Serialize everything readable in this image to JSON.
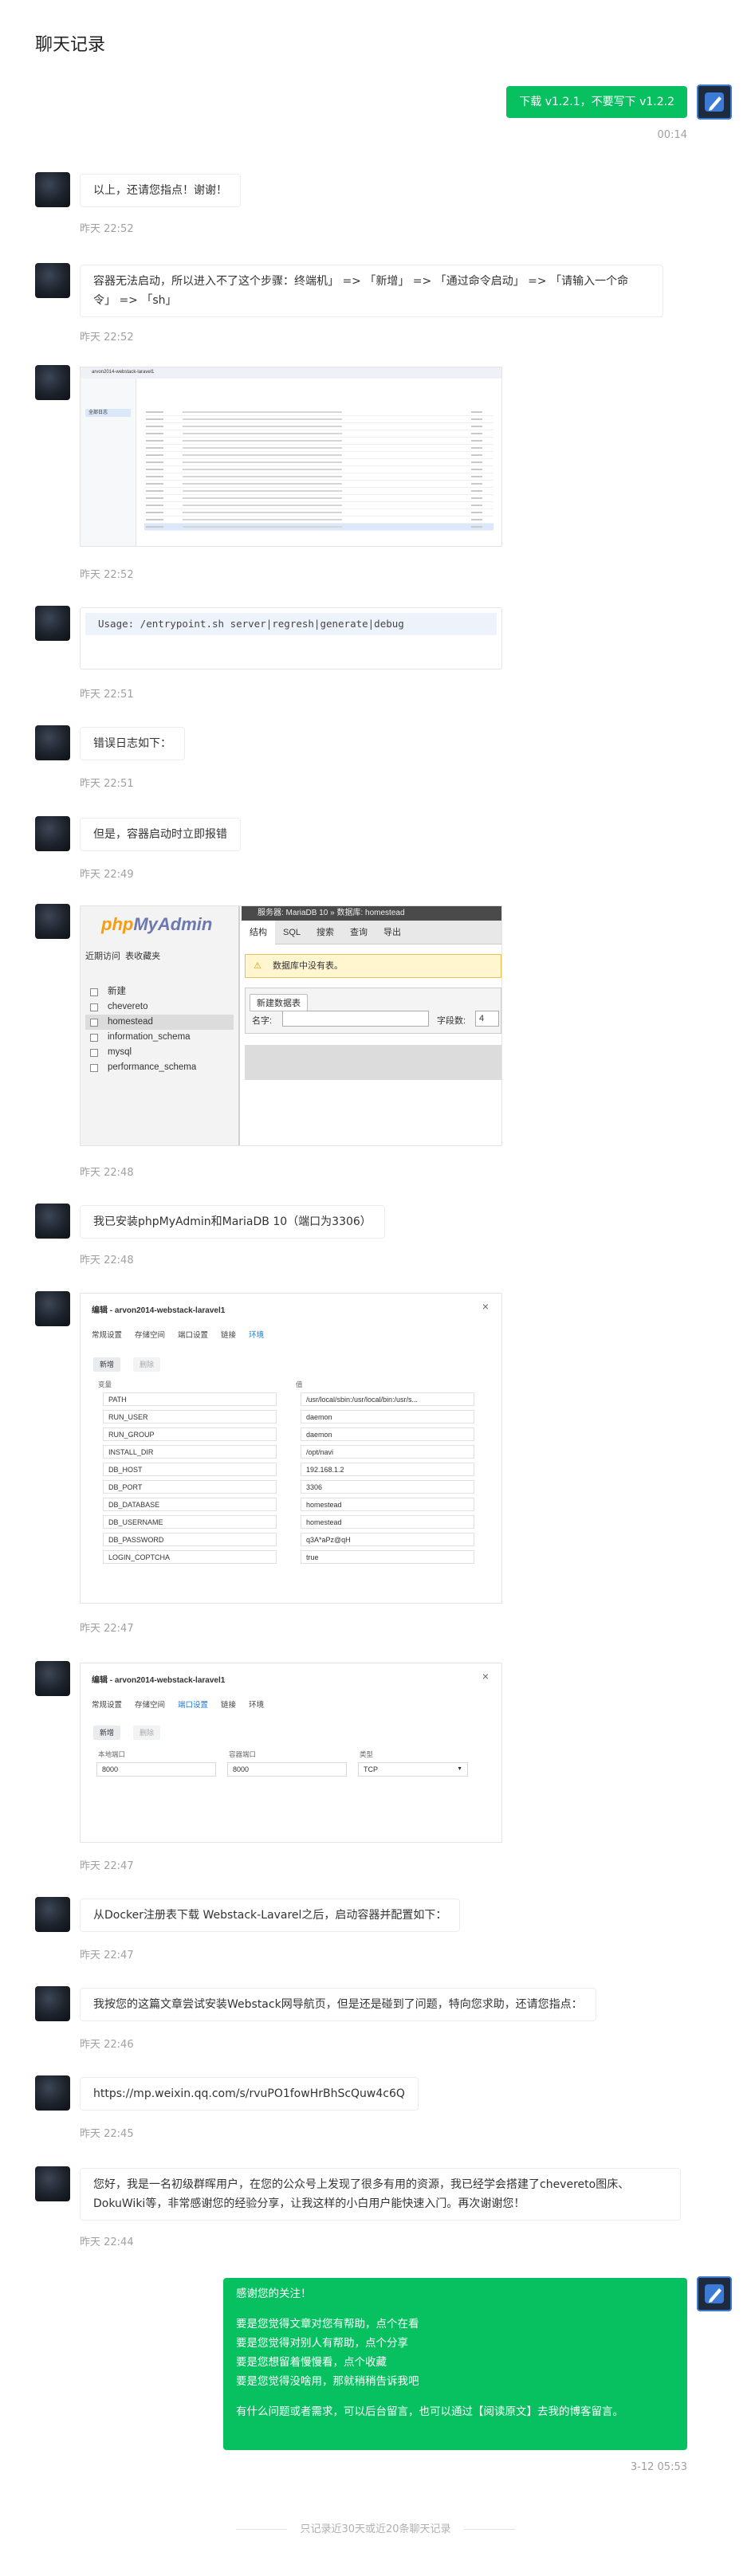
{
  "page": {
    "title": "聊天记录"
  },
  "messages": {
    "m01": {
      "text": "下载 v1.2.1，不要写下 v1.2.2",
      "time": "00:14"
    },
    "m02": {
      "text": "以上，还请您指点！谢谢！",
      "time": "昨天 22:52"
    },
    "m03": {
      "text": "容器无法启动，所以进入不了这个步骤：终端机」 => 「新增」 => 「通过命令启动」 => 「请输入一个命令」 => 「sh」",
      "time": "昨天 22:52"
    },
    "m04": {
      "time": "昨天 22:52"
    },
    "m05": {
      "code": "Usage: /entrypoint.sh server|regresh|generate|debug",
      "time": "昨天 22:51"
    },
    "m06": {
      "text": "错误日志如下：",
      "time": "昨天 22:51"
    },
    "m07": {
      "text": "但是，容器启动时立即报错",
      "time": "昨天 22:49"
    },
    "m08": {
      "time": "昨天 22:48"
    },
    "m09": {
      "text": "我已安装phpMyAdmin和MariaDB 10（端口为3306）",
      "time": "昨天 22:48"
    },
    "m10": {
      "time": "昨天 22:47"
    },
    "m11": {
      "time": "昨天 22:47"
    },
    "m12": {
      "text": "从Docker注册表下载 Webstack-Lavarel之后，启动容器并配置如下：",
      "time": "昨天 22:47"
    },
    "m13": {
      "text": "我按您的这篇文章尝试安装Webstack网导航页，但是还是碰到了问题，特向您求助，还请您指点：",
      "time": "昨天 22:46"
    },
    "m14": {
      "text": "https://mp.weixin.qq.com/s/rvuPO1fowHrBhScQuw4c6Q",
      "time": "昨天 22:45"
    },
    "m15": {
      "text": "您好，我是一名初级群晖用户，在您的公众号上发现了很多有用的资源，我已经学会搭建了chevereto图床、DokuWiki等，非常感谢您的经验分享，让我这样的小白用户能快速入门。再次谢谢您！",
      "time": "昨天 22:44"
    },
    "m16": {
      "line1": "感谢您的关注！",
      "line2": "要是您觉得文章对您有帮助，点个在看",
      "line3": "要是您觉得对别人有帮助，点个分享",
      "line4": "要是您想留着慢慢看，点个收藏",
      "line5": "要是您觉得没啥用，那就稍稍告诉我吧",
      "line6": "有什么问题或者需求，可以后台留言，也可以通过【阅读原文】去我的博客留言。",
      "time": "3-12 05:53"
    }
  },
  "log_screenshot": {
    "title": "arvon2014-webstack-laravel1",
    "sidebar_item": "全部日志",
    "row_count": 17
  },
  "pma_screenshot": {
    "logo_php": "php",
    "logo_myadmin": "MyAdmin",
    "recent": "近期访问",
    "favorites": "表收藏夹",
    "tree": [
      "新建",
      "chevereto",
      "homestead",
      "information_schema",
      "mysql",
      "performance_schema"
    ],
    "topbar": "服务器: MariaDB 10 » 数据库: homestead",
    "tabs": [
      "结构",
      "SQL",
      "搜索",
      "查询",
      "导出"
    ],
    "notice": "数据库中没有表。",
    "new_table": "新建数据表",
    "name_label": "名字:",
    "fields_label": "字段数:",
    "fields_value": "4"
  },
  "env_dialog": {
    "title": "编辑 - arvon2014-webstack-laravel1",
    "tabs": [
      "常规设置",
      "存储空间",
      "端口设置",
      "链接",
      "环境"
    ],
    "active_tab": "环境",
    "add_btn": "新增",
    "del_btn": "删除",
    "col_var": "变量",
    "col_val": "值",
    "rows": [
      {
        "k": "PATH",
        "v": "/usr/local/sbin:/usr/local/bin:/usr/s..."
      },
      {
        "k": "RUN_USER",
        "v": "daemon"
      },
      {
        "k": "RUN_GROUP",
        "v": "daemon"
      },
      {
        "k": "INSTALL_DIR",
        "v": "/opt/navi"
      },
      {
        "k": "DB_HOST",
        "v": "192.168.1.2"
      },
      {
        "k": "DB_PORT",
        "v": "3306"
      },
      {
        "k": "DB_DATABASE",
        "v": "homestead"
      },
      {
        "k": "DB_USERNAME",
        "v": "homestead"
      },
      {
        "k": "DB_PASSWORD",
        "v": "q3A*aPz@qH"
      },
      {
        "k": "LOGIN_COPTCHA",
        "v": "true"
      }
    ]
  },
  "port_dialog": {
    "title": "编辑 - arvon2014-webstack-laravel1",
    "tabs": [
      "常规设置",
      "存储空间",
      "端口设置",
      "链接",
      "环境"
    ],
    "active_tab": "端口设置",
    "add_btn": "新增",
    "del_btn": "删除",
    "col_local": "本地端口",
    "col_container": "容器端口",
    "col_type": "类型",
    "local_port": "8000",
    "container_port": "8000",
    "type": "TCP"
  },
  "footer": {
    "text": "只记录近30天或近20条聊天记录"
  },
  "colors": {
    "accent": "#07c160",
    "time": "#a0a0a0"
  }
}
